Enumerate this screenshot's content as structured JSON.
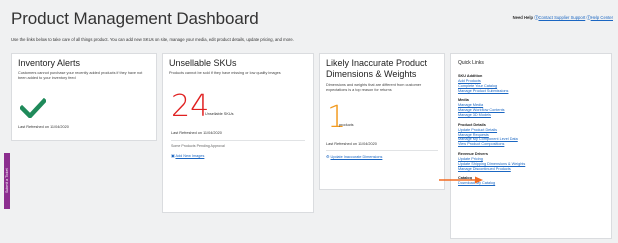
{
  "page": {
    "title": "Product Management Dashboard",
    "intro": "Use the links below to take care of all things product. You can add new SKUs on site, manage your media, edit product details, update pricing, and more."
  },
  "help": {
    "label": "Need Help",
    "link1": "Contact Supplier Support",
    "link2": "Help Center"
  },
  "side_tab": {
    "label": "Submit a Ticket"
  },
  "inventory_alerts": {
    "title": "Inventory Alerts",
    "description": "Customers cannot purchase your recently added products if they have not been added to your inventory feed",
    "icon": "checkmark-icon",
    "last_refreshed": "Last Refreshed on 11/04/2020"
  },
  "unsellable_skus": {
    "title": "Unsellable SKUs",
    "description": "Products cannot be sold if they have missing or low quality images",
    "count": "24",
    "count_label": "Unsellable SKUs",
    "last_refreshed": "Last Refreshed on 11/04/2020",
    "note": "Some Products Pending Approval",
    "link": "Add New Images"
  },
  "inaccurate_dims": {
    "title": "Likely Inaccurate Product Dimensions & Weights",
    "description": "Dimensions and weights that are different from customer expectations is a top reason for returns",
    "count": "1",
    "count_label": "products",
    "last_refreshed": "Last Refreshed on 11/04/2020",
    "link": "Update Inaccurate Dimensions"
  },
  "quick_links": {
    "title": "Quick Links",
    "groups": [
      {
        "heading": "SKU Addition",
        "links": [
          "Add Products",
          "Complete Your Catalog",
          "Manage Product Submissions"
        ]
      },
      {
        "heading": "Media",
        "links": [
          "Manage Media",
          "Manage Workflow Contents",
          "Manage 3D Models"
        ]
      },
      {
        "heading": "Product Details",
        "links": [
          "Update Product Details",
          "Manage Requests",
          "Manage My Component Level Data",
          "View Product Compositions"
        ]
      },
      {
        "heading": "Revenue Drivers",
        "links": [
          "Update Pricing",
          "Update Shipping Dimensions & Weights",
          "Manage Discontinued Products"
        ]
      },
      {
        "heading": "Catalog",
        "links": [
          "Download My Catalog"
        ]
      }
    ]
  },
  "colors": {
    "link": "#1a66c2",
    "alert_red": "#e02020",
    "count_orange": "#f29a1e",
    "check_green": "#1f8a5a",
    "side_tab": "#8c2e8f",
    "arrow": "#f26b21"
  }
}
